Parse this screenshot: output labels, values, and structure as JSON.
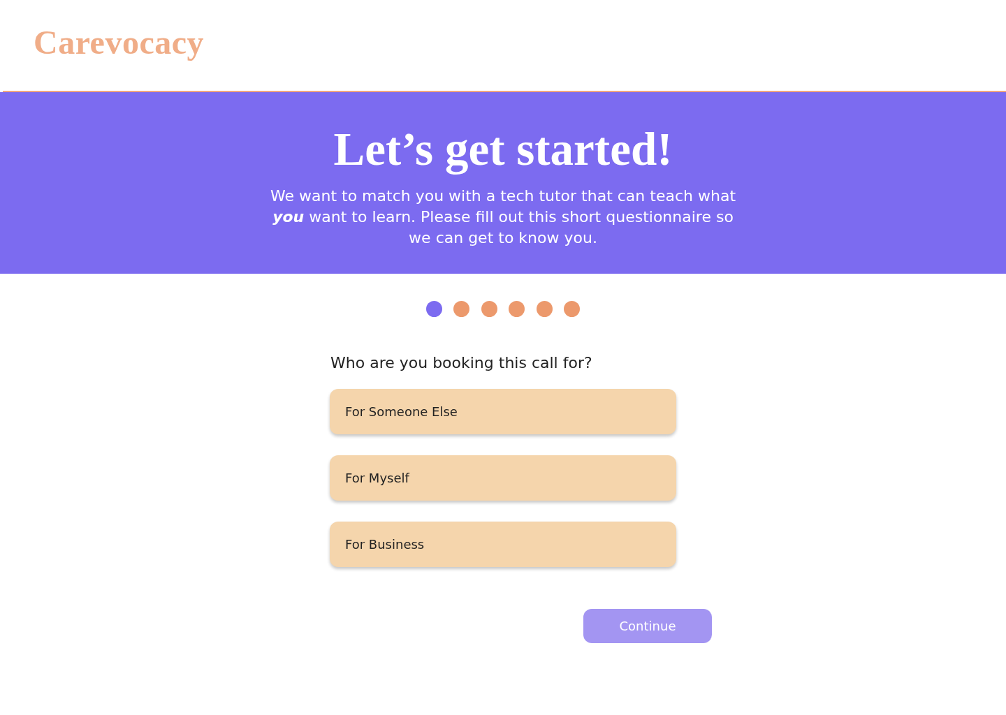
{
  "header": {
    "logo": "Carevocacy"
  },
  "banner": {
    "title": "Let’s get started!",
    "subtitle": "We want to match you with a tech tutor that can teach what **you** want to learn. Please fill out this short questionnaire so we can get to know you."
  },
  "steps": [
    {
      "selected": true
    },
    {
      "selected": false
    },
    {
      "selected": false
    },
    {
      "selected": false
    },
    {
      "selected": false
    },
    {
      "selected": false
    }
  ],
  "question": {
    "text": "Who are you booking this call for?",
    "options": [
      {
        "label": "For Someone Else",
        "selected": false
      },
      {
        "label": "For Myself",
        "selected": false
      },
      {
        "label": "For Business",
        "selected": false
      }
    ]
  },
  "continue_button": {
    "label": "Continue",
    "disabled": true
  }
}
